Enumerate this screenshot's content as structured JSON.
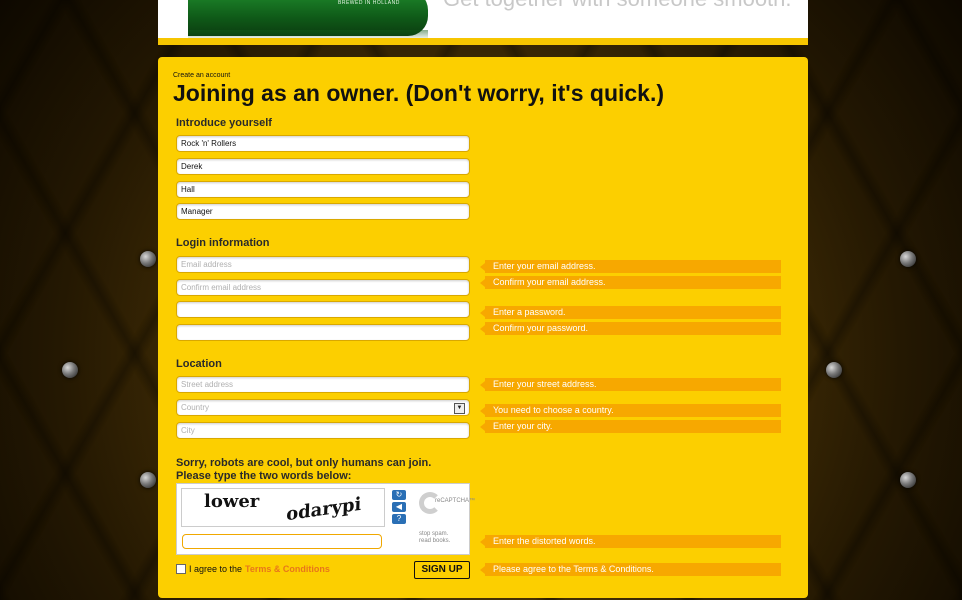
{
  "banner": {
    "slogan": "Get together with someone smooth.",
    "bottle_label": "BREWED IN HOLLAND"
  },
  "form": {
    "breadcrumb": "Create an account",
    "title": "Joining as an owner. (Don't worry, it's quick.)",
    "sections": {
      "introduce": "Introduce yourself",
      "login": "Login information",
      "location": "Location"
    },
    "intro_fields": {
      "company": "Rock 'n' Rollers",
      "first_name": "Derek",
      "last_name": "Hall",
      "position": "Manager"
    },
    "login_fields": {
      "email_placeholder": "Email address",
      "confirm_email_placeholder": "Confirm email address",
      "password": "",
      "confirm_password": ""
    },
    "location_fields": {
      "street_placeholder": "Street address",
      "country_placeholder": "Country",
      "city_placeholder": "City"
    },
    "hints": {
      "email": "Enter your email address.",
      "confirm_email": "Confirm your email address.",
      "password": "Enter a password.",
      "confirm_password": "Confirm your password.",
      "street": "Enter your street address.",
      "country": "You need to choose a country.",
      "city": "Enter your city.",
      "captcha": "Enter the distorted words.",
      "terms": "Please agree to the Terms & Conditions."
    },
    "captcha": {
      "instruction_line1": "Sorry, robots are cool, but only humans can join.",
      "instruction_line2": "Please type the two words below:",
      "word1": "lower",
      "word2": "odarypi",
      "logo_text": "reCAPTCHA™",
      "note_line1": "stop spam.",
      "note_line2": "read books."
    },
    "agree_text": "I agree to the",
    "terms_link": "Terms & Conditions",
    "signup_label": "SIGN UP"
  },
  "colors": {
    "panel": "#fccf00",
    "hint": "#f7a800",
    "link": "#e8771a"
  }
}
